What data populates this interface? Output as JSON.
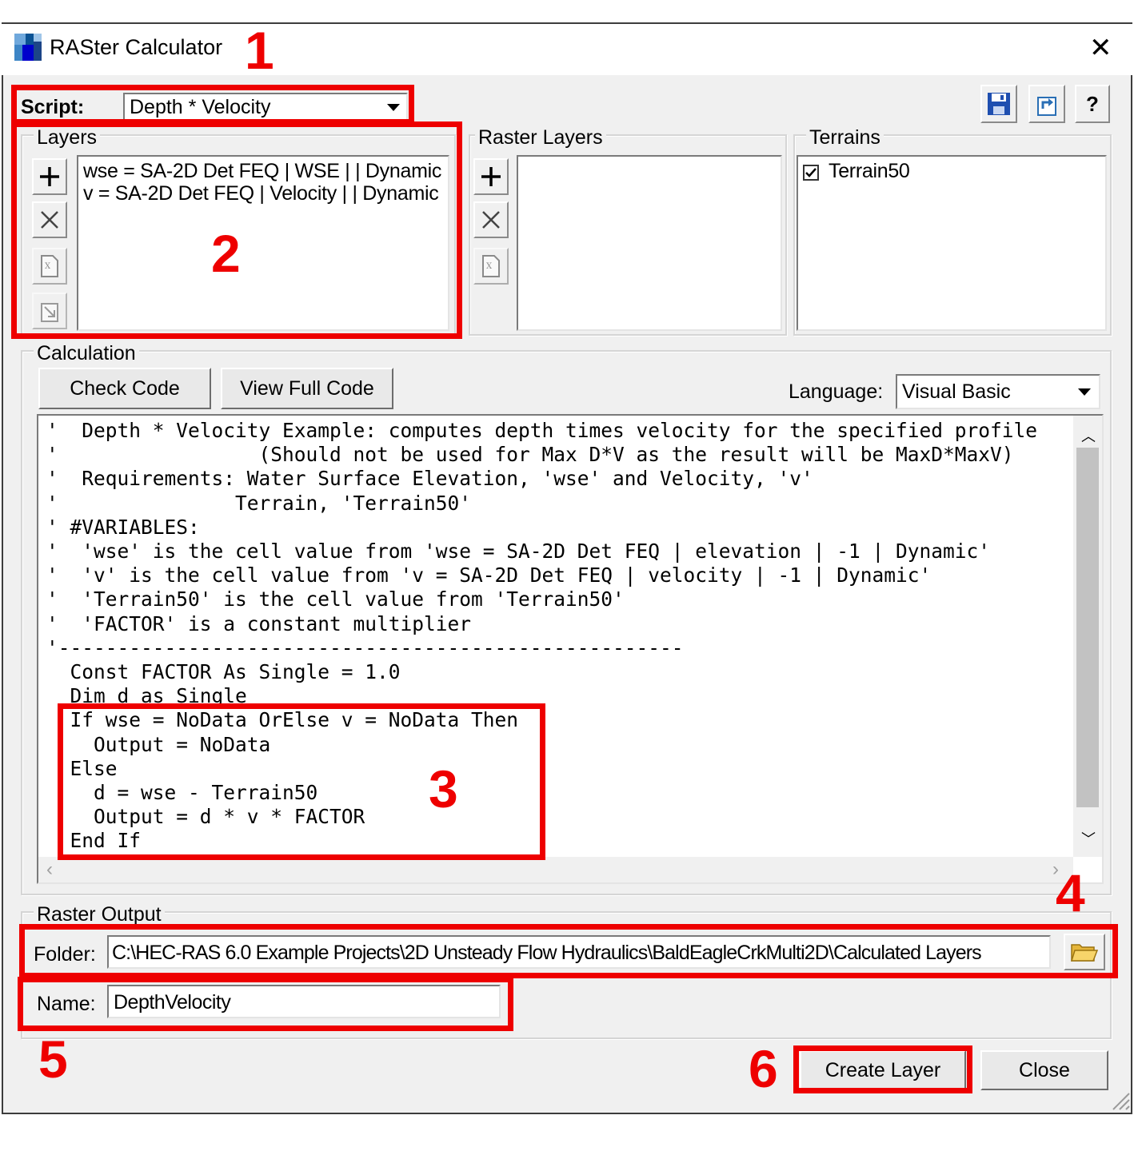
{
  "window": {
    "title": "RASter Calculator"
  },
  "script": {
    "label": "Script:",
    "value": "Depth * Velocity"
  },
  "toolbar": {
    "save_icon": "floppy-disk-icon",
    "restore_icon": "restore-icon",
    "help_label": "?"
  },
  "layers": {
    "title": "Layers",
    "items": [
      "wse = SA-2D Det FEQ | WSE |  | Dynamic",
      "v = SA-2D Det FEQ | Velocity |  | Dynamic"
    ]
  },
  "raster_layers": {
    "title": "Raster Layers",
    "items": []
  },
  "terrains": {
    "title": "Terrains",
    "items": [
      {
        "label": "Terrain50",
        "checked": true
      }
    ]
  },
  "calculation": {
    "title": "Calculation",
    "check_code": "Check Code",
    "view_full_code": "View Full Code",
    "language_label": "Language:",
    "language_value": "Visual Basic",
    "code_lines": [
      "'  Depth * Velocity Example: computes depth times velocity for the specified profile",
      "'                 (Should not be used for Max D*V as the result will be MaxD*MaxV)",
      "'  Requirements: Water Surface Elevation, 'wse' and Velocity, 'v'",
      "'               Terrain, 'Terrain50'",
      "' #VARIABLES:",
      "'  'wse' is the cell value from 'wse = SA-2D Det FEQ | elevation | -1 | Dynamic'",
      "'  'v' is the cell value from 'v = SA-2D Det FEQ | velocity | -1 | Dynamic'",
      "'  'Terrain50' is the cell value from 'Terrain50'",
      "'  'FACTOR' is a constant multiplier",
      "'-----------------------------------------------------",
      "  Const FACTOR As Single = 1.0",
      "  Dim d as Single",
      "  If wse = NoData OrElse v = NoData Then",
      "    Output = NoData",
      "  Else",
      "    d = wse - Terrain50",
      "    Output = d * v * FACTOR",
      "  End If"
    ]
  },
  "raster_output": {
    "title": "Raster Output",
    "folder_label": "Folder:",
    "folder_value": "C:\\HEC-RAS 6.0 Example Projects\\2D Unsteady Flow Hydraulics\\BaldEagleCrkMulti2D\\Calculated Layers",
    "name_label": "Name:",
    "name_value": "DepthVelocity"
  },
  "buttons": {
    "create_layer": "Create Layer",
    "close": "Close"
  },
  "annotations": [
    "1",
    "2",
    "3",
    "4",
    "5",
    "6"
  ],
  "colors": {
    "annotation_red": "#ee0000",
    "window_bg": "#f0f0f0",
    "scrollbar_thumb": "#c2c2c2"
  }
}
